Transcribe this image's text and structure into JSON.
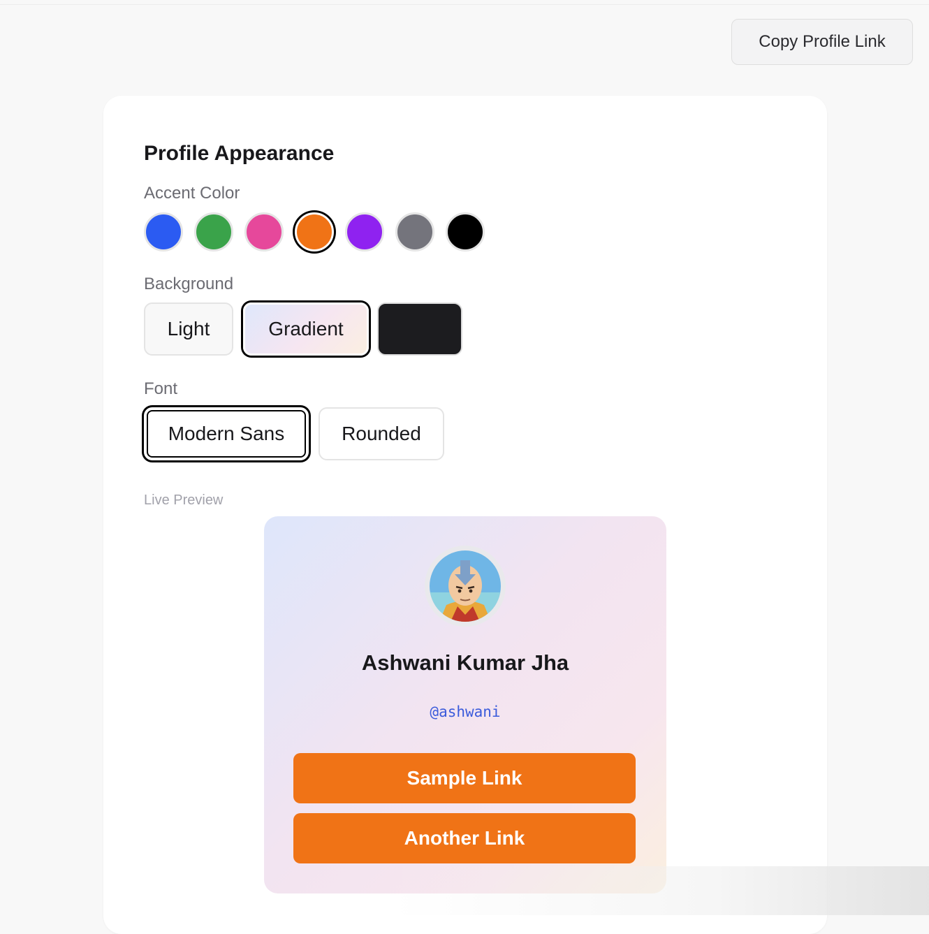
{
  "header": {
    "copy_link_label": "Copy Profile Link"
  },
  "settings": {
    "title": "Profile Appearance",
    "accent_label": "Accent Color",
    "accent_colors": [
      {
        "name": "blue",
        "hex": "#2b5bf2"
      },
      {
        "name": "green",
        "hex": "#3aa34a"
      },
      {
        "name": "pink",
        "hex": "#e6489b"
      },
      {
        "name": "orange",
        "hex": "#f07316"
      },
      {
        "name": "purple",
        "hex": "#8f22f0"
      },
      {
        "name": "gray",
        "hex": "#74747c"
      },
      {
        "name": "black",
        "hex": "#000000"
      }
    ],
    "selected_accent": "orange",
    "background_label": "Background",
    "background_options": {
      "light": "Light",
      "gradient": "Gradient",
      "dark": ""
    },
    "selected_background": "Gradient",
    "font_label": "Font",
    "font_options": {
      "modern": "Modern Sans",
      "rounded": "Rounded"
    },
    "selected_font": "Modern Sans",
    "preview_label": "Live Preview"
  },
  "preview": {
    "avatar_icon": "avatar-illustration",
    "name": "Ashwani Kumar Jha",
    "handle": "@ashwani",
    "links": [
      "Sample Link",
      "Another Link"
    ],
    "accent_hex": "#f07316"
  }
}
